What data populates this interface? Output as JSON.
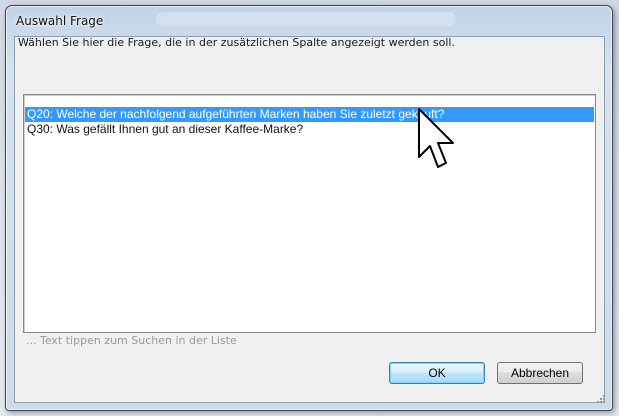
{
  "window": {
    "title": "Auswahl Frage"
  },
  "instruction": "Wählen Sie hier die Frage, die in der zusätzlichen Spalte angezeigt werden soll.",
  "list": {
    "items": [
      {
        "label": "Q20: Welche der nachfolgend aufgeführten Marken haben Sie zuletzt gekauft?",
        "selected": true
      },
      {
        "label": "Q30: Was gefällt Ihnen gut an dieser Kaffee-Marke?",
        "selected": false
      }
    ]
  },
  "search": {
    "hint": "... Text tippen zum Suchen in der Liste"
  },
  "buttons": {
    "ok_label": "OK",
    "cancel_label": "Abbrechen"
  },
  "colors": {
    "selection": "#3399ff",
    "selection_text": "#ffffff",
    "frame": "#c9d9ea"
  },
  "icons": {
    "cursor": "arrow-cursor-icon",
    "resize_grip": "resize-grip-icon"
  }
}
